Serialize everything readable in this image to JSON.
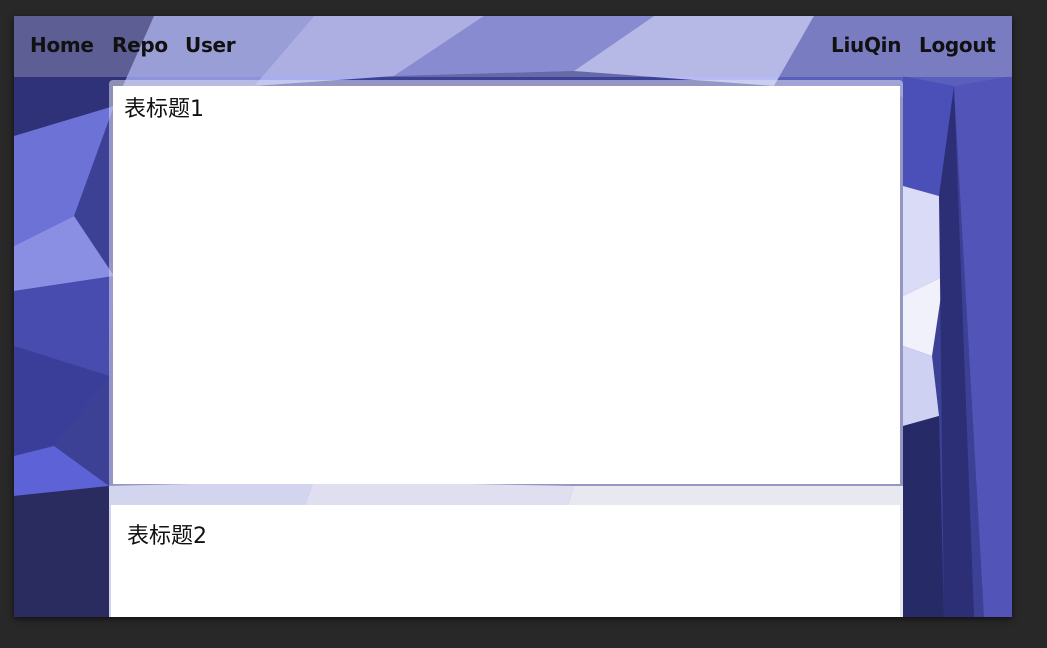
{
  "nav": {
    "left": [
      "Home",
      "Repo",
      "User"
    ],
    "right": [
      "LiuQin",
      "Logout"
    ]
  },
  "cards": [
    {
      "title": "表标题1"
    },
    {
      "title": "表标题2"
    }
  ],
  "icons": [
    "low-poly-background"
  ],
  "colors": {
    "window_bg": "#282828",
    "topbar": "rgba(180,180,200,0.35)",
    "card": "#ffffff",
    "text": "#111111"
  }
}
